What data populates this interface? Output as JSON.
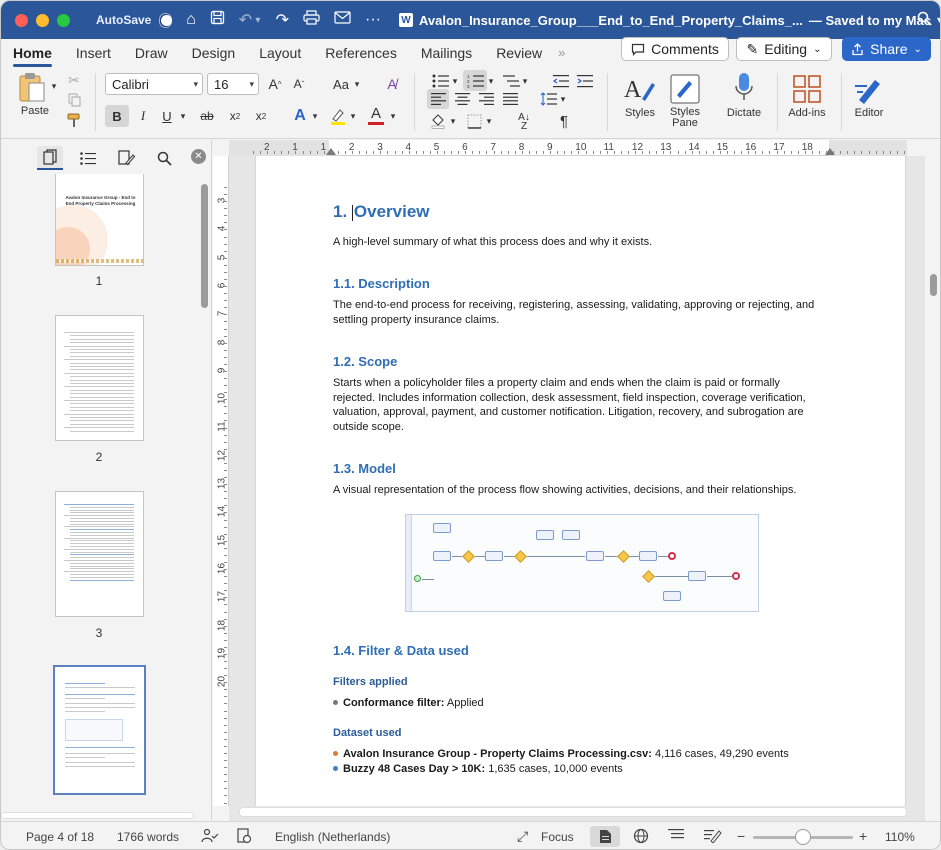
{
  "titlebar": {
    "autosave_label": "AutoSave",
    "doc_title": "Avalon_Insurance_Group___End_to_End_Property_Claims_...",
    "save_status": "— Saved to my Mac",
    "app_badge": "W"
  },
  "tabs": [
    "Home",
    "Insert",
    "Draw",
    "Design",
    "Layout",
    "References",
    "Mailings",
    "Review"
  ],
  "tab_more": "»",
  "actions": {
    "comments": "Comments",
    "editing": "Editing",
    "share": "Share"
  },
  "ribbon": {
    "paste_label": "Paste",
    "font_name": "Calibri",
    "font_size": "16",
    "grow_font": "A",
    "shrink_font": "A",
    "change_case": "Aa",
    "bold": "B",
    "italic": "I",
    "underline": "U",
    "strike": "ab",
    "subscript": "x",
    "superscript": "x",
    "sub_marker": "2",
    "sup_marker": "2",
    "text_effects": "A",
    "font_color": "A",
    "pilcrow": "¶",
    "styles_label": "Styles",
    "styles_pane_label": "Styles\nPane",
    "dictate_label": "Dictate",
    "addins_label": "Add-ins",
    "editor_label": "Editor"
  },
  "ruler": {
    "h_numbers": [
      "2",
      "1",
      "1",
      "2",
      "3",
      "4",
      "5",
      "6",
      "7",
      "8",
      "9",
      "10",
      "11",
      "12",
      "13",
      "14",
      "15",
      "16",
      "17",
      "18"
    ],
    "v_numbers": [
      "3",
      "4",
      "5",
      "6",
      "7",
      "8",
      "9",
      "10",
      "11",
      "12",
      "13",
      "14",
      "15",
      "16",
      "17",
      "18",
      "19",
      "20"
    ]
  },
  "nav": {
    "page_numbers": [
      "1",
      "2",
      "3"
    ],
    "thumb1_title": "Avalon Insurance Group - End to End Property Claims Processing"
  },
  "document": {
    "h1_number": "1.",
    "h1_title": "Overview",
    "overview_text": "A high-level summary of what this process does and why it exists.",
    "desc_heading": "1.1. Description",
    "desc_text": "The end-to-end process for receiving, registering, assessing, validating, approving or rejecting, and settling property insurance claims.",
    "scope_heading": "1.2. Scope",
    "scope_text": "Starts when a policyholder files a property claim and ends when the claim is paid or formally rejected. Includes information collection, desk assessment, field inspection, coverage verification, valuation, approval, payment, and customer notification. Litigation, recovery, and subrogation are outside scope.",
    "model_heading": "1.3. Model",
    "model_text": "A visual representation of the process flow showing activities, decisions, and their relationships.",
    "filter_heading": "1.4. Filter & Data used",
    "filters_applied": "Filters applied",
    "filter_item_bold": "Conformance filter:",
    "filter_item_value": "Applied",
    "dataset_used": "Dataset used",
    "dataset1_bold": "Avalon Insurance Group - Property Claims Processing.csv:",
    "dataset1_value": "4,116 cases, 49,290 events",
    "dataset2_bold": "Buzzy 48 Cases Day > 10K:",
    "dataset2_value": "1,635 cases, 10,000 events"
  },
  "colors": {
    "word_blue": "#2b579a",
    "heading_blue": "#2f6eb5",
    "dataset1_dot": "#e07b2e",
    "dataset2_dot": "#3d7fd6",
    "filter_dot": "#777777"
  },
  "status": {
    "page": "Page 4 of 18",
    "words": "1766 words",
    "language": "English (Netherlands)",
    "focus": "Focus",
    "zoom_minus": "−",
    "zoom_plus": "+",
    "zoom": "110%"
  }
}
